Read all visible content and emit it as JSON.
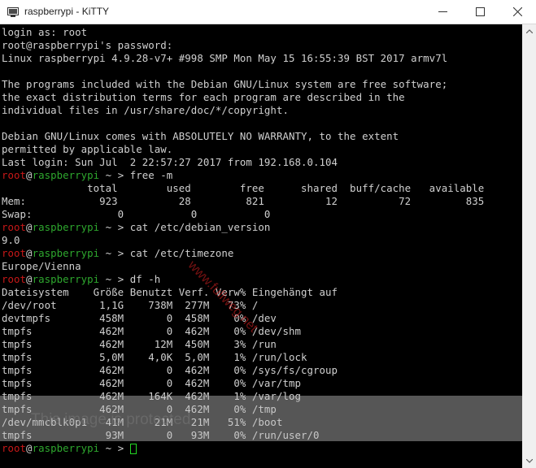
{
  "window": {
    "title": "raspberrypi - KiTTY",
    "icon": "monitor-icon",
    "controls": [
      "minimize-icon",
      "maximize-icon",
      "close-icon"
    ]
  },
  "colors": {
    "prompt_user": "#c81818",
    "prompt_host": "#2ea82e",
    "text": "#d0d0d0",
    "cursor": "#23d823",
    "watermark": "#d42020"
  },
  "terminal": {
    "lines": [
      {
        "t": "text",
        "text": "login as: root"
      },
      {
        "t": "text",
        "text": "root@raspberrypi's password:"
      },
      {
        "t": "text",
        "text": "Linux raspberrypi 4.9.28-v7+ #998 SMP Mon May 15 16:55:39 BST 2017 armv7l"
      },
      {
        "t": "text",
        "text": ""
      },
      {
        "t": "text",
        "text": "The programs included with the Debian GNU/Linux system are free software;"
      },
      {
        "t": "text",
        "text": "the exact distribution terms for each program are described in the"
      },
      {
        "t": "text",
        "text": "individual files in /usr/share/doc/*/copyright."
      },
      {
        "t": "text",
        "text": ""
      },
      {
        "t": "text",
        "text": "Debian GNU/Linux comes with ABSOLUTELY NO WARRANTY, to the extent"
      },
      {
        "t": "text",
        "text": "permitted by applicable law."
      },
      {
        "t": "text",
        "text": "Last login: Sun Jul  2 22:57:27 2017 from 192.168.0.104"
      },
      {
        "t": "prompt",
        "user": "root",
        "at": "@",
        "host": "raspberrypi",
        "rest": " ~ > free -m"
      },
      {
        "t": "text",
        "text": "              total        used        free      shared  buff/cache   available"
      },
      {
        "t": "text",
        "text": "Mem:            923          28         821          12          72         835"
      },
      {
        "t": "text",
        "text": "Swap:              0           0           0"
      },
      {
        "t": "prompt",
        "user": "root",
        "at": "@",
        "host": "raspberrypi",
        "rest": " ~ > cat /etc/debian_version"
      },
      {
        "t": "text",
        "text": "9.0"
      },
      {
        "t": "prompt",
        "user": "root",
        "at": "@",
        "host": "raspberrypi",
        "rest": " ~ > cat /etc/timezone"
      },
      {
        "t": "text",
        "text": "Europe/Vienna"
      },
      {
        "t": "prompt",
        "user": "root",
        "at": "@",
        "host": "raspberrypi",
        "rest": " ~ > df -h"
      },
      {
        "t": "text",
        "text": "Dateisystem    Größe Benutzt Verf. Verw% Eingehängt auf"
      },
      {
        "t": "text",
        "text": "/dev/root       1,1G    738M  277M   73% /"
      },
      {
        "t": "text",
        "text": "devtmpfs        458M       0  458M    0% /dev"
      },
      {
        "t": "text",
        "text": "tmpfs           462M       0  462M    0% /dev/shm"
      },
      {
        "t": "text",
        "text": "tmpfs           462M     12M  450M    3% /run"
      },
      {
        "t": "text",
        "text": "tmpfs           5,0M    4,0K  5,0M    1% /run/lock"
      },
      {
        "t": "text",
        "text": "tmpfs           462M       0  462M    0% /sys/fs/cgroup"
      },
      {
        "t": "text",
        "text": "tmpfs           462M       0  462M    0% /var/tmp"
      },
      {
        "t": "text",
        "text": "tmpfs           462M    164K  462M    1% /var/log"
      },
      {
        "t": "text",
        "text": "tmpfs           462M       0  462M    0% /tmp"
      },
      {
        "t": "text",
        "text": "/dev/mmcblk0p1   41M     21M   21M   51% /boot"
      },
      {
        "t": "text",
        "text": "tmpfs            93M       0   93M    0% /run/user/0"
      },
      {
        "t": "prompt",
        "user": "root",
        "at": "@",
        "host": "raspberrypi",
        "rest": " ~ > ",
        "cursor": true
      }
    ]
  },
  "watermark": {
    "text": "www.fullweg.net"
  },
  "overlay": {
    "text": "This image is protected"
  },
  "scrollbar": {
    "up_icon": "scroll-up-icon",
    "down_icon": "scroll-down-icon"
  }
}
